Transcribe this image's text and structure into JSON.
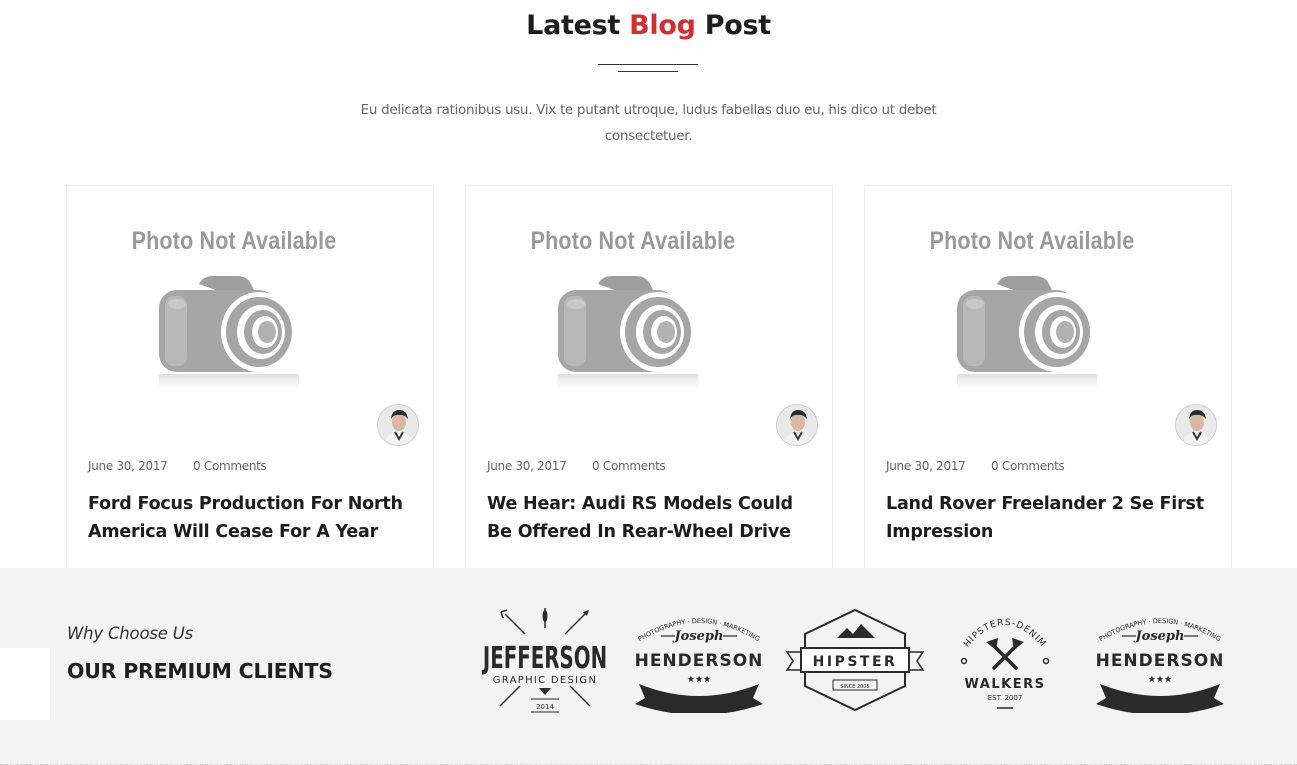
{
  "blog": {
    "title_before": "Latest ",
    "title_accent": "Blog",
    "title_after": " Post",
    "intro": "Eu delicata rationibus usu. Vix te putant utroque, ludus fabellas duo eu, his dico ut debet consectetuer.",
    "accent_color": "#d0302f",
    "posts": [
      {
        "thumb_text": "Photo Not Available",
        "date": "June 30, 2017",
        "comments": "0 Comments",
        "title": "Ford Focus Production For North America Will Cease For A Year"
      },
      {
        "thumb_text": "Photo Not Available",
        "date": "June 30, 2017",
        "comments": "0 Comments",
        "title": "We Hear: Audi RS Models Could Be Offered In Rear-Wheel Drive"
      },
      {
        "thumb_text": "Photo Not Available",
        "date": "June 30, 2017",
        "comments": "0 Comments",
        "title": "Land Rover Freelander 2 Se First Impression"
      }
    ]
  },
  "clients": {
    "subtitle": "Why Choose Us",
    "heading": "OUR PREMIUM CLIENTS",
    "logos": {
      "jefferson": {
        "name": "JEFFERSON",
        "tagline": "GRAPHIC DESIGN",
        "year": "2014"
      },
      "henderson": {
        "arc": "PHOTOGRAPHY · DESIGN · MARKETING",
        "script": "Joseph",
        "name": "HENDERSON",
        "stars": "★★★"
      },
      "hipster": {
        "name": "HIPSTER",
        "since": "SINCE 2005"
      },
      "walkers": {
        "arc": "HIPSTERS-DENIM",
        "name": "WALKERS",
        "est": "EST. 2007"
      }
    }
  }
}
